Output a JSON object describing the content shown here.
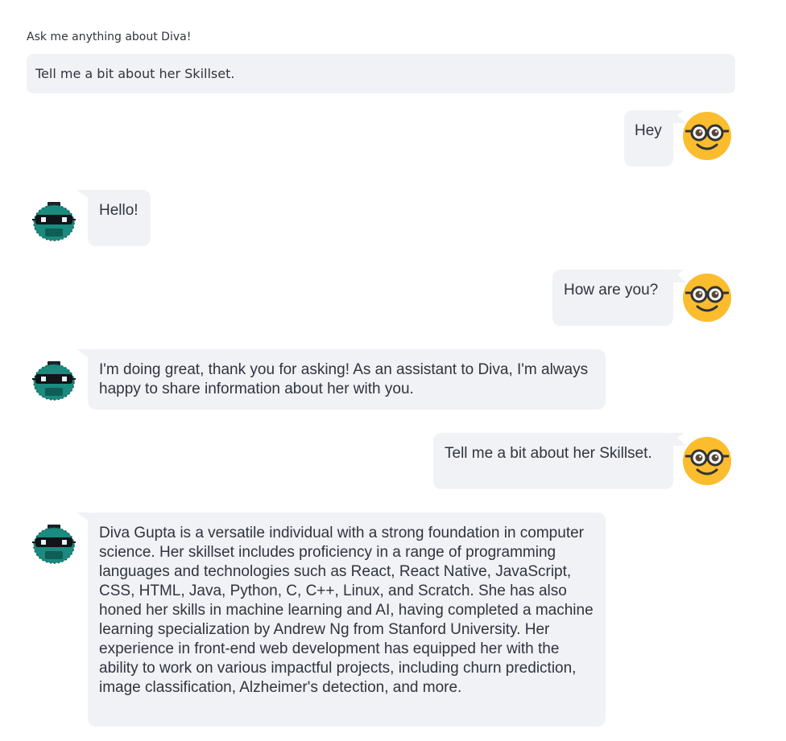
{
  "input": {
    "label": "Ask me anything about Diva!",
    "value": "Tell me a bit about her Skillset."
  },
  "messages": [
    {
      "role": "user",
      "avatar_icon": "nerd-face-icon",
      "text": "Hey"
    },
    {
      "role": "bot",
      "avatar_icon": "robot-icon",
      "text": "Hello!"
    },
    {
      "role": "user",
      "avatar_icon": "nerd-face-icon",
      "text": "How are you?"
    },
    {
      "role": "bot",
      "avatar_icon": "robot-icon",
      "text": "I'm doing great, thank you for asking! As an assistant to Diva, I'm always happy to share information about her with you."
    },
    {
      "role": "user",
      "avatar_icon": "nerd-face-icon",
      "text": "Tell me a bit about her Skillset."
    },
    {
      "role": "bot",
      "avatar_icon": "robot-icon",
      "text": "Diva Gupta is a versatile individual with a strong foundation in computer science. Her skillset includes proficiency in a range of programming languages and technologies such as React, React Native, JavaScript, CSS, HTML, Java, Python, C, C++, Linux, and Scratch. She has also honed her skills in machine learning and AI, having completed a machine learning specialization by Andrew Ng from Stanford University. Her experience in front-end web development has equipped her with the ability to work on various impactful projects, including churn prediction, image classification, Alzheimer's detection, and more."
    }
  ],
  "colors": {
    "bubble": "#f0f2f6",
    "text": "#31333f",
    "user_avatar": "#fbbc2e",
    "bot_avatar": "#1a8b7e"
  }
}
